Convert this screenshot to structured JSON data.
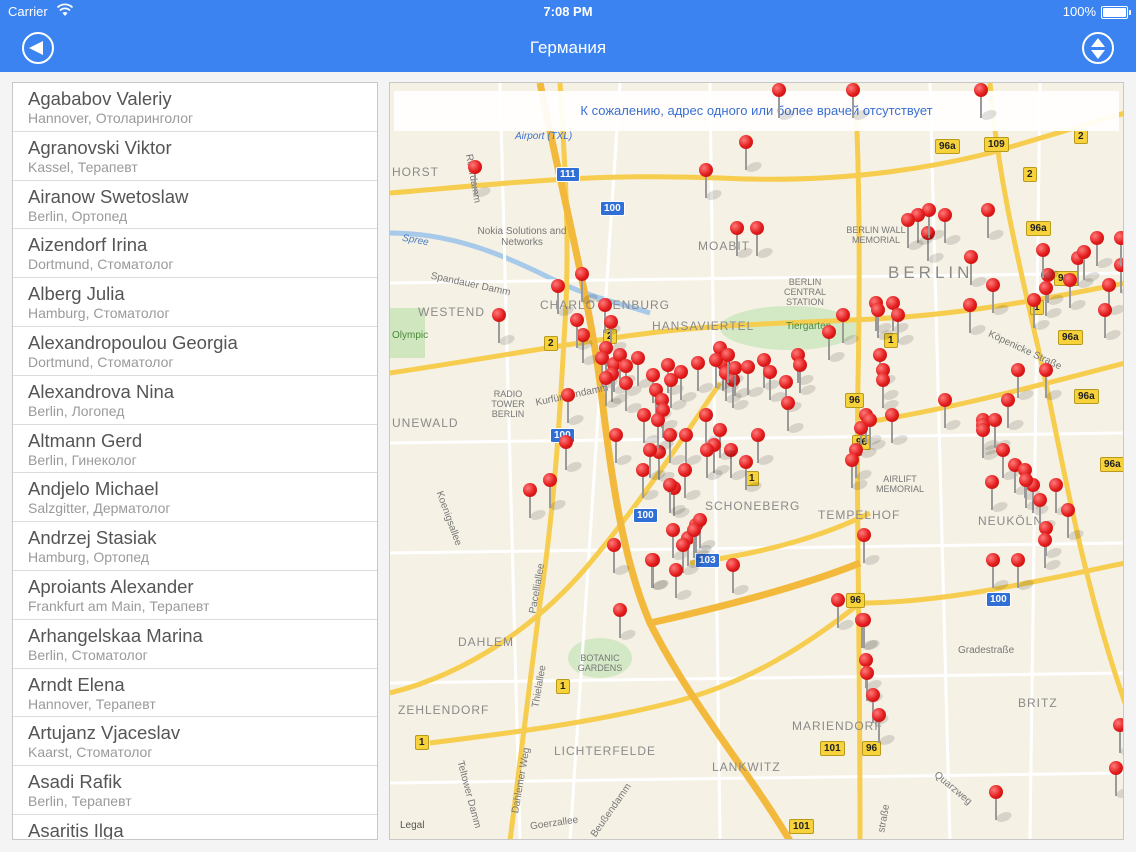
{
  "status_bar": {
    "carrier": "Carrier",
    "time": "7:08 PM",
    "battery": "100%"
  },
  "nav": {
    "title": "Германия"
  },
  "doctors": [
    {
      "name": "Agababov Valeriy",
      "detail": "Hannover, Отоларинголог"
    },
    {
      "name": "Agranovski Viktor",
      "detail": "Kassel, Терапевт"
    },
    {
      "name": "Airanow Swetoslaw",
      "detail": "Berlin, Ортопед"
    },
    {
      "name": "Aizendorf Irina",
      "detail": "Dortmund, Стоматолог"
    },
    {
      "name": "Alberg Julia",
      "detail": "Hamburg, Стоматолог"
    },
    {
      "name": "Alexandropoulou Georgia",
      "detail": "Dortmund, Стоматолог"
    },
    {
      "name": "Alexandrova Nina",
      "detail": "Berlin, Логопед"
    },
    {
      "name": "Altmann Gerd",
      "detail": "Berlin, Гинеколог"
    },
    {
      "name": "Andjelo Michael",
      "detail": "Salzgitter, Дерматолог"
    },
    {
      "name": "Andrzej Stasiak",
      "detail": "Hamburg, Ортопед"
    },
    {
      "name": "Aproiants Alexander",
      "detail": "Frankfurt am Main, Терапевт"
    },
    {
      "name": "Arhangelskaa Marina",
      "detail": "Berlin, Стоматолог"
    },
    {
      "name": "Arndt Elena",
      "detail": "Hannover, Терапевт"
    },
    {
      "name": "Artujanz Vjaceslav",
      "detail": "Kaarst, Стоматолог"
    },
    {
      "name": "Asadi Rafik",
      "detail": "Berlin, Терапевт"
    },
    {
      "name": "Asaritis Ilga",
      "detail": ""
    }
  ],
  "map": {
    "banner": "К сожалению, адрес одного или более врачей отсутствует",
    "legal": "Legal",
    "districts": {
      "berlin": "BERLIN",
      "westend": "WESTEND",
      "charlottenburg": "CHARLOTTENBURG",
      "hansaviertel": "HANSAVIERTEL",
      "moabit": "MOABIT",
      "schoneberg": "SCHONEBERG",
      "tempelhof": "TEMPELHOF",
      "neukoln": "NEUKÖLN",
      "dahlem": "DAHLEM",
      "zehlendorf": "ZEHLENDORF",
      "lichterfelde": "LICHTERFELDE",
      "lankwitz": "LANKWITZ",
      "mariendorf": "MARIENDORF",
      "britz": "BRITZ",
      "grunewald": "UNEWALD",
      "horst": "HORST"
    },
    "places": {
      "airport": "Airport (TXL)",
      "nokia": "Nokia Solutions and Networks",
      "wall_memorial": "BERLIN WALL MEMORIAL",
      "central_station": "BERLIN CENTRAL STATION",
      "tiergarten": "Tiergarten",
      "radio_tower": "RADIO TOWER BERLIN",
      "airlift": "AIRLIFT MEMORIAL",
      "botanic": "BOTANIC GARDENS",
      "olympic": "Olympic"
    },
    "roads": {
      "spandauer": "Spandauer Damm",
      "kurfurstendamm": "Kurfürstendamm",
      "spree": "Spree",
      "koenigsallee": "Koenigsallee",
      "pacelliallee": "Pacelliallee",
      "thielallee": "Thielallee",
      "gradestrasse": "Gradestraße",
      "kopenicker": "Köpenicke Straße",
      "dahlemer": "Dahlemer Weg",
      "teltower": "Teltower Damm",
      "goerzallee": "Goerzallee",
      "beussendamm": "Beußendamm",
      "quarzweg": "Quarzweg",
      "rohrdamm": "Rohrdamm",
      "strasse": "straße"
    },
    "badges": {
      "b111": "111",
      "b100a": "100",
      "b100b": "100",
      "b100c": "100",
      "b100d": "100",
      "b103": "103",
      "b96a1": "96a",
      "b109": "109",
      "b2a": "2",
      "b2b": "2",
      "b2c": "2",
      "b2d": "2",
      "b96a2": "96a",
      "b96a3": "96a",
      "b1a": "1",
      "b1b": "1",
      "b96a4": "96a",
      "b96a5": "96a",
      "b96a6": "96a",
      "b96b": "96",
      "b96c": "96",
      "b96d": "96",
      "b96e": "96",
      "b101a": "101",
      "b101b": "101",
      "b1c": "1",
      "b1d": "1",
      "b1e": "1"
    }
  }
}
